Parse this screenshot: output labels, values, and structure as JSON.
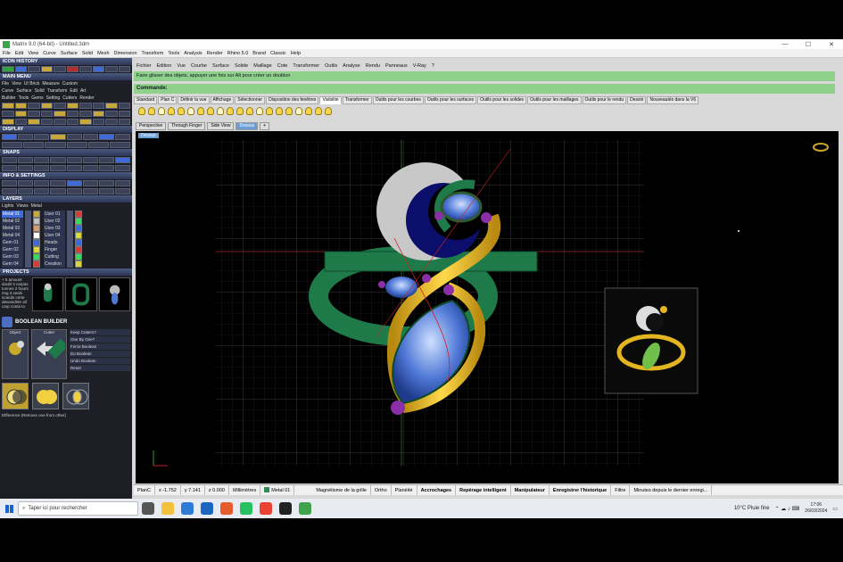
{
  "window": {
    "title": "Matrix 9.0 (64-bit) - Untitled.3dm"
  },
  "top_menu": [
    "File",
    "Edit",
    "View",
    "Curve",
    "Surface",
    "Solid",
    "Mesh",
    "Dimension",
    "Transform",
    "Tools",
    "Analysis",
    "Render",
    "Rhino 5.0",
    "Brand",
    "Classic",
    "Help"
  ],
  "left_panel": {
    "icon_history": "ICON HISTORY",
    "main_menu": "MAIN MENU",
    "menu_row1": [
      "File",
      "View",
      "UI Brick",
      "Measure",
      "Custom"
    ],
    "menu_row2": [
      "Curve",
      "Surface",
      "Solid",
      "Transform",
      "Edit",
      "Art"
    ],
    "menu_row3": [
      "Builder",
      "Tools",
      "Gems",
      "Setting",
      "Cutters",
      "Render"
    ],
    "display": "DISPLAY",
    "snaps": "SNAPS",
    "info_settings": "INFO & SETTINGS",
    "layers": "LAYERS",
    "layers_toolbar": [
      "Lights",
      "Views",
      "Metal"
    ],
    "layers_col1": [
      {
        "name": "Metal 01",
        "color": "#c8a83a",
        "selected": true
      },
      {
        "name": "Metal 02",
        "color": "#c0c0c0",
        "selected": false
      },
      {
        "name": "Metal 03",
        "color": "#d89b6a",
        "selected": false
      },
      {
        "name": "Metal 04",
        "color": "#ffffff",
        "selected": false
      },
      {
        "name": "Gem 01",
        "color": "#3f6ad8",
        "selected": false
      },
      {
        "name": "Gem 02",
        "color": "#d8d83a",
        "selected": false
      },
      {
        "name": "Gem 03",
        "color": "#3ad860",
        "selected": false
      },
      {
        "name": "Gem 04",
        "color": "#d83a3a",
        "selected": false
      }
    ],
    "layers_col2": [
      {
        "name": "User 01",
        "color": "#d83a3a"
      },
      {
        "name": "User 02",
        "color": "#3ad860"
      },
      {
        "name": "User 03",
        "color": "#3a6ad8"
      },
      {
        "name": "User 04",
        "color": "#d8d83a"
      },
      {
        "name": "Heads",
        "color": "#3a6ad8"
      },
      {
        "name": "Finger",
        "color": "#d83a3a"
      },
      {
        "name": "Cutting",
        "color": "#3ad860"
      },
      {
        "name": "Creation",
        "color": "#d8d83a"
      }
    ],
    "projects": "PROJECTS",
    "projects_text": "+ 5 amount doubl 3 carpas tonnes 2 hours ring 3 seals scands certe alexandrite all carp conta to",
    "boolean_title": "BOOLEAN BUILDER",
    "bool_object_label": "Object",
    "bool_cutter_label": "Cutter",
    "bool_options": [
      "Keep Cutters?",
      "One By One?",
      "Force Boolean",
      "Do Boolean",
      "Undo Boolean",
      "Reset"
    ],
    "bool_caption": "Difference (Remove one from other)"
  },
  "rhino_menu": [
    "Fichier",
    "Edition",
    "Vue",
    "Courbe",
    "Surface",
    "Solide",
    "Maillage",
    "Cote",
    "Transformer",
    "Outils",
    "Analyse",
    "Rendu",
    "Panneaux",
    "V-Ray",
    "?"
  ],
  "command_history": "Faire glisser des objets, appuyer une fois sur Alt pour créer un doublon",
  "command_prompt": "Commande:",
  "toolbar_tabs": [
    "Standard",
    "Plan C",
    "Définir la vue",
    "Affichage",
    "Sélectionner",
    "Disposition des fenêtres",
    "Visibilité",
    "Transformer",
    "Outils pour les courbes",
    "Outils pour les surfaces",
    "Outils pour les solides",
    "Outils pour les maillages",
    "Outils pour le rendu",
    "Dessin",
    "Nouveautés dans la V6"
  ],
  "active_toolbar_tab": "Visibilité",
  "viewport_tabs": [
    "Perspective",
    "Through Finger",
    "Side View",
    "Dessus"
  ],
  "active_viewport_tab": "Dessus",
  "viewport_label": "Dessus",
  "status": {
    "cplane": "PlanC",
    "x": "x -1.752",
    "y": "y 7.141",
    "z": "z 0.000",
    "units": "Millimètres",
    "layer": "Metal 01",
    "grid_snap": "Magnétisme de la grille",
    "ortho": "Ortho",
    "planar": "Planéité",
    "osnap": "Accrochages",
    "smarttrack": "Repérage intelligent",
    "gumball": "Manipulateur",
    "history": "Enregistrer l'historique",
    "filter": "Filtre",
    "since_save": "Minutes depuis le dernier enregi..."
  },
  "taskbar": {
    "search_placeholder": "Taper ici pour rechercher",
    "weather": "10°C  Pluie fine",
    "time": "17:06",
    "date": "26/03/2024"
  },
  "colors": {
    "command_green": "#8fd18b",
    "gold": "#e3b520",
    "green_metal": "#1f7a4a",
    "gem_blue": "#4f78d6",
    "accent_purple": "#8b2fa8"
  }
}
